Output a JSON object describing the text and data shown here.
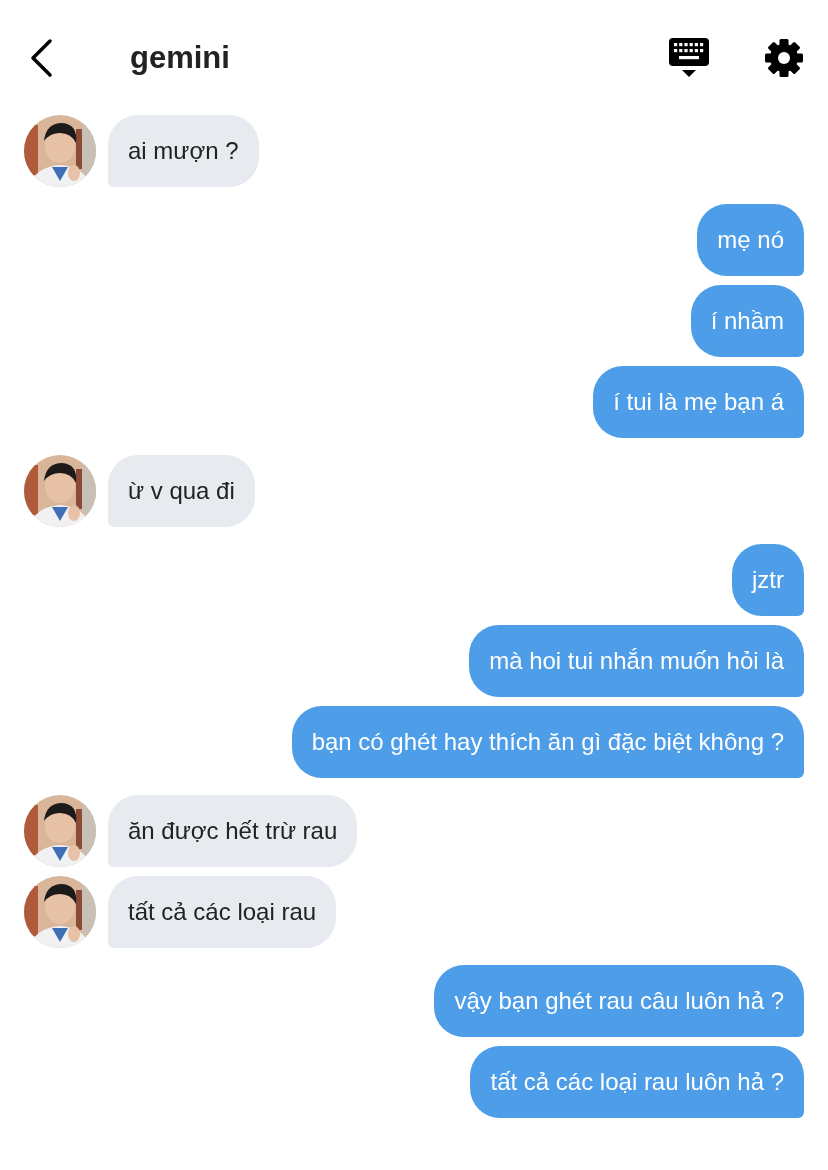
{
  "header": {
    "title": "gemini"
  },
  "messages": [
    {
      "kind": "incoming",
      "text": "ai mượn ?"
    },
    {
      "kind": "outgoing",
      "text": "mẹ nó"
    },
    {
      "kind": "outgoing",
      "text": "í nhầm"
    },
    {
      "kind": "outgoing",
      "text": "í tui là mẹ bạn á"
    },
    {
      "kind": "incoming",
      "text": "ừ v qua đi"
    },
    {
      "kind": "outgoing",
      "text": "jztr"
    },
    {
      "kind": "outgoing",
      "text": "mà hoi tui nhắn muốn hỏi là"
    },
    {
      "kind": "outgoing",
      "text": "bạn có ghét hay thích ăn gì đặc biệt không ?"
    },
    {
      "kind": "incoming",
      "text": "ăn được hết trừ rau"
    },
    {
      "kind": "incoming",
      "text": "tất cả các loại rau"
    },
    {
      "kind": "outgoing",
      "text": "vậy bạn ghét rau câu luôn hả ?"
    },
    {
      "kind": "outgoing",
      "text": "tất cả các loại rau luôn hả ?"
    }
  ]
}
